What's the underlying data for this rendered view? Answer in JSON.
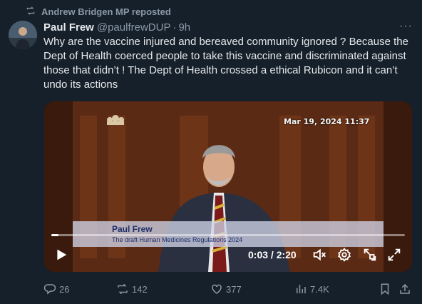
{
  "repost_banner": {
    "text": "Andrew Bridgen MP reposted"
  },
  "tweet": {
    "author_name": "Paul Frew",
    "handle": "@paulfrewDUP",
    "separator": "·",
    "time": "9h",
    "text": "Why are the vaccine injured and bereaved community ignored ? Because the Dept of Health coerced people to take this vaccine and discriminated against those that didn’t ! The Dept of Health crossed a ethical Rubicon and it can’t undo its actions"
  },
  "video": {
    "overlay_timestamp": "Mar 19, 2024 11:37",
    "lower_third_name": "Paul Frew",
    "lower_third_subtitle": "The draft Human Medicines Regulations 2024",
    "time_readout": "0:03 / 2:20",
    "progress_fraction": 0.021
  },
  "actions": {
    "replies": "26",
    "reposts": "142",
    "likes": "377",
    "views": "7.4K"
  },
  "colors": {
    "background": "#15202b",
    "text": "#e7e9ea",
    "muted": "#8b98a5"
  }
}
